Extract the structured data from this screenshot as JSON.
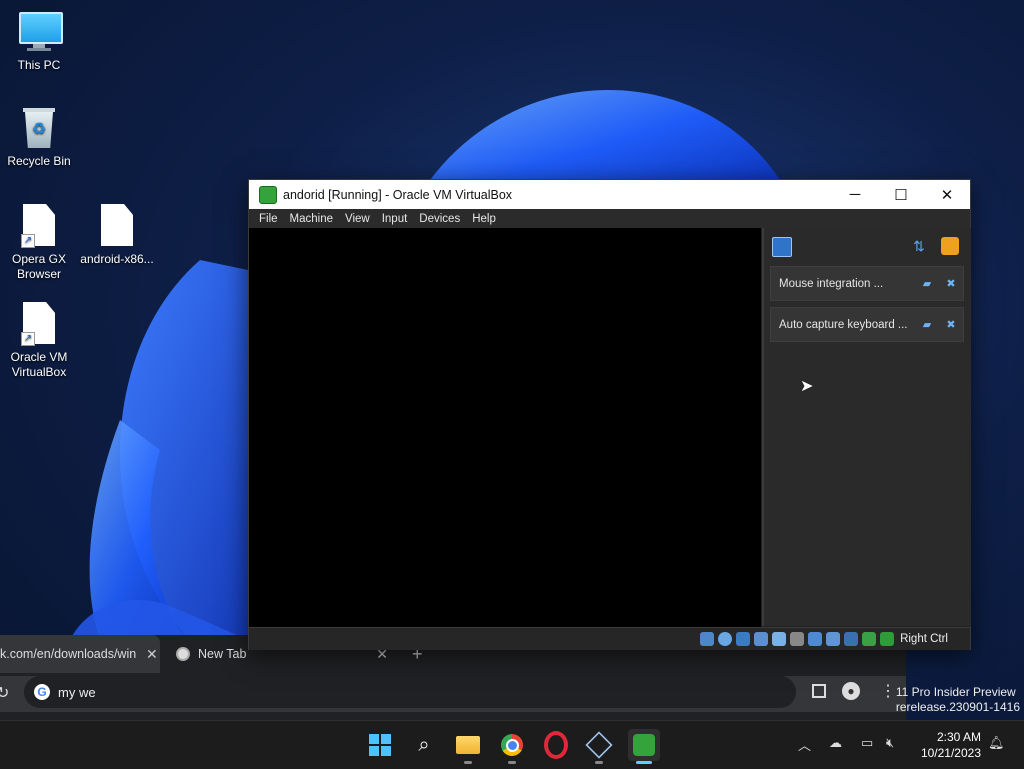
{
  "desktop": {
    "icons": [
      {
        "label": "This PC"
      },
      {
        "label": "Recycle Bin"
      },
      {
        "label": "Opera GX Browser"
      },
      {
        "label": "android-x86..."
      },
      {
        "label": "Oracle VM VirtualBox"
      }
    ]
  },
  "vbox": {
    "title": "andorid [Running] - Oracle VM VirtualBox",
    "menu": [
      "File",
      "Machine",
      "View",
      "Input",
      "Devices",
      "Help"
    ],
    "notifications": [
      {
        "text": "Mouse integration ..."
      },
      {
        "text": "Auto capture keyboard ..."
      }
    ],
    "host_key": "Right Ctrl"
  },
  "browser": {
    "tabs": [
      {
        "title": "k.com/en/downloads/win"
      },
      {
        "title": "New Tab"
      }
    ],
    "new_tab_symbol": "+",
    "omnibox_text": "my we"
  },
  "watermark": {
    "line1": "11 Pro Insider Preview",
    "line2": "rerelease.230901-1416"
  },
  "taskbar": {
    "time": "2:30 AM",
    "date": "10/21/2023",
    "pinned": [
      "start-icon",
      "search-icon",
      "file-explorer-icon",
      "chrome-icon",
      "opera-icon",
      "virtualbox-manager-icon",
      "virtualbox-vm-icon"
    ]
  },
  "colors": {
    "accent": "#60cdff",
    "vbox_green": "#35a33b",
    "taskbar_bg": "#1c1c1c"
  }
}
